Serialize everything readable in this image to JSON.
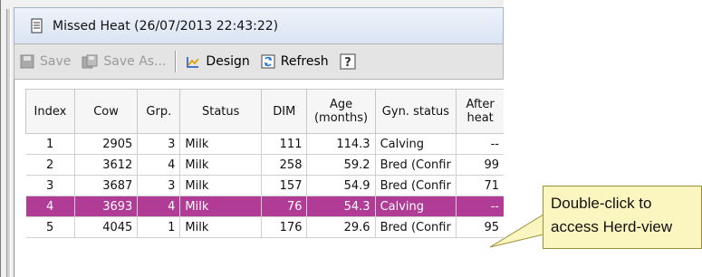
{
  "window": {
    "title": "Missed Heat (26/07/2013 22:43:22)"
  },
  "toolbar": {
    "save_label": "Save",
    "save_as_label": "Save As...",
    "design_label": "Design",
    "refresh_label": "Refresh",
    "help_label": "?"
  },
  "table": {
    "headers": {
      "index": "Index",
      "cow": "Cow",
      "grp": "Grp.",
      "status": "Status",
      "dim": "DIM",
      "age": "Age (months)",
      "gyn": "Gyn. status",
      "after": "After heat"
    },
    "rows": [
      {
        "index": "1",
        "cow": "2905",
        "grp": "3",
        "status": "Milk",
        "dim": "111",
        "age": "114.3",
        "gyn": "Calving",
        "after": "--"
      },
      {
        "index": "2",
        "cow": "3612",
        "grp": "4",
        "status": "Milk",
        "dim": "258",
        "age": "59.2",
        "gyn": "Bred (Confir",
        "after": "99"
      },
      {
        "index": "3",
        "cow": "3687",
        "grp": "3",
        "status": "Milk",
        "dim": "157",
        "age": "54.9",
        "gyn": "Bred (Confir",
        "after": "71"
      },
      {
        "index": "4",
        "cow": "3693",
        "grp": "4",
        "status": "Milk",
        "dim": "76",
        "age": "54.3",
        "gyn": "Calving",
        "after": "--"
      },
      {
        "index": "5",
        "cow": "4045",
        "grp": "1",
        "status": "Milk",
        "dim": "176",
        "age": "29.6",
        "gyn": "Bred (Confir",
        "after": "95"
      }
    ],
    "selected_index": "4"
  },
  "callout": {
    "text": "Double-click to access Herd-view"
  },
  "colors": {
    "selected_row": "#b03c96",
    "callout_bg": "#fbf5c0"
  }
}
